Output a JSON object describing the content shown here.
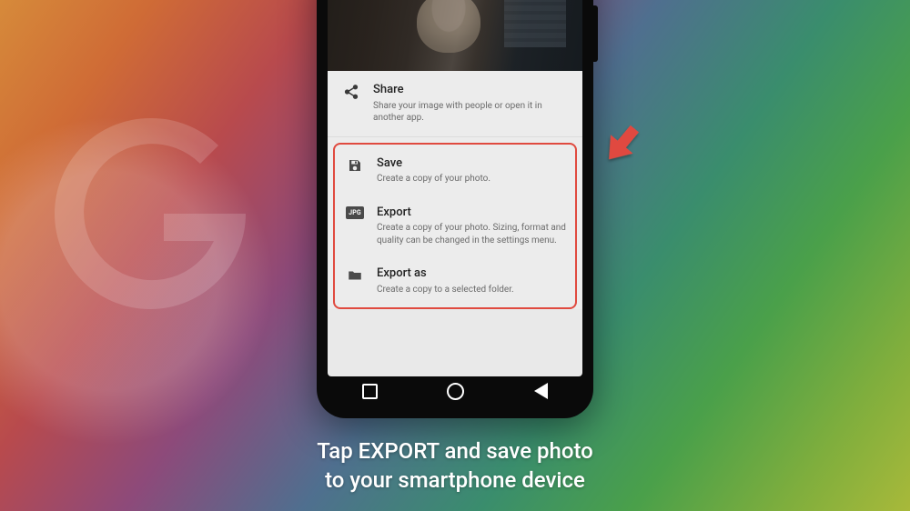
{
  "caption_line1": "Tap EXPORT and save photo",
  "caption_line2": "to your smartphone device",
  "share": {
    "title": "Share",
    "desc": "Share your image with people or open it in another app."
  },
  "options": {
    "save": {
      "title": "Save",
      "desc": "Create a copy of your photo."
    },
    "export": {
      "title": "Export",
      "desc": "Create a copy of your photo. Sizing, format and quality can be changed in the settings menu.",
      "badge": "JPG"
    },
    "export_as": {
      "title": "Export as",
      "desc": "Create a copy to a selected folder."
    }
  },
  "highlight_color": "#e04a3f"
}
